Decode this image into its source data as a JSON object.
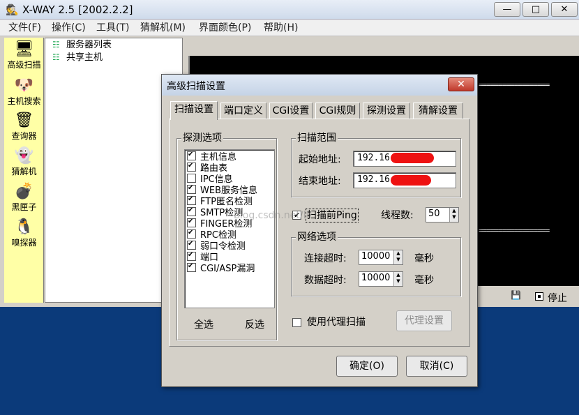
{
  "app": {
    "title": "X-WAY 2.5 [2002.2.2]"
  },
  "window_controls": {
    "minimize": "—",
    "maximize": "□",
    "close": "✕"
  },
  "menu": [
    "文件(F)",
    "操作(C)",
    "工具(T)",
    "猜解机(M)",
    "界面颜色(P)",
    "帮助(H)"
  ],
  "toolbar": [
    {
      "label": "高级扫描",
      "icon": "monitor-icon"
    },
    {
      "label": "主机搜索",
      "icon": "dog-icon"
    },
    {
      "label": "查询器",
      "icon": "trashcan-icon"
    },
    {
      "label": "猜解机",
      "icon": "ghost-icon"
    },
    {
      "label": "黑匣子",
      "icon": "bomb-icon"
    },
    {
      "label": "嗅探器",
      "icon": "penguin-icon"
    }
  ],
  "tree": [
    "服务器列表",
    "共享主机"
  ],
  "console": {
    "line": "=================="
  },
  "status": {
    "stop": "停止"
  },
  "dialog": {
    "title": "高级扫描设置",
    "tabs": [
      "扫描设置",
      "端口定义",
      "CGI设置",
      "CGI规则",
      "探测设置",
      "猜解设置"
    ],
    "active_tab": 0,
    "probe_group": {
      "title": "探测选项",
      "items": [
        {
          "label": "主机信息",
          "checked": true
        },
        {
          "label": "路由表",
          "checked": true
        },
        {
          "label": "IPC信息",
          "checked": false
        },
        {
          "label": "WEB服务信息",
          "checked": true
        },
        {
          "label": "FTP匿名检测",
          "checked": true
        },
        {
          "label": "SMTP检测",
          "checked": true
        },
        {
          "label": "FINGER检测",
          "checked": true
        },
        {
          "label": "RPC检测",
          "checked": true
        },
        {
          "label": "弱口令检测",
          "checked": true
        },
        {
          "label": "端口",
          "checked": true
        },
        {
          "label": "CGI/ASP漏洞",
          "checked": true
        }
      ],
      "select_all": "全选",
      "invert": "反选"
    },
    "range_group": {
      "title": "扫描范围",
      "start_label": "起始地址:",
      "start_value": "192.16",
      "end_label": "结束地址:",
      "end_value": "192.16"
    },
    "ping": {
      "label": "扫描前Ping",
      "checked": true
    },
    "threads": {
      "label": "线程数:",
      "value": "50"
    },
    "network_group": {
      "title": "网络选项",
      "connect_label": "连接超时:",
      "connect_value": "10000",
      "data_label": "数据超时:",
      "data_value": "10000",
      "unit": "毫秒"
    },
    "proxy": {
      "label": "使用代理扫描",
      "checked": false,
      "settings": "代理设置"
    },
    "watermark": "blog.csdn.net/lif",
    "ok": "确定(O)",
    "cancel": "取消(C)"
  }
}
